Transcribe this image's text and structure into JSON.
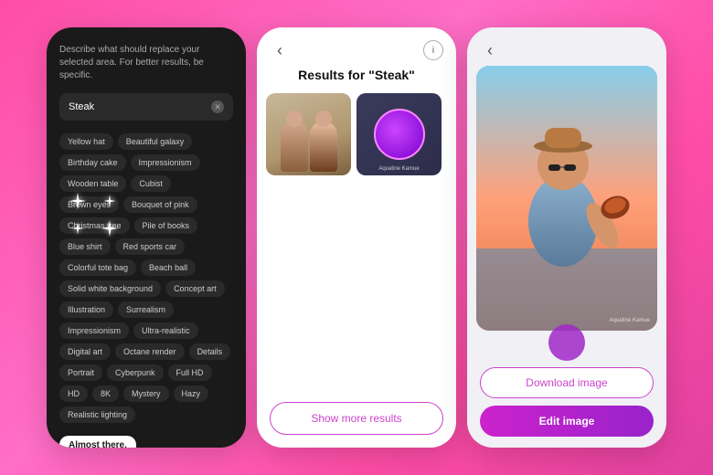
{
  "panel1": {
    "prompt_label": "Describe what should replace your selected area. For better results, be specific.",
    "prompt_value": "Steak",
    "chips": [
      "Yellow hat",
      "Beautiful galaxy",
      "Birthday cake",
      "Impressionism",
      "Wooden table",
      "Cubist",
      "Brown eyes",
      "Bouquet of pink",
      "Christmas tree",
      "Pile of books",
      "Blue shirt",
      "Red sports car",
      "Colorful tote bag",
      "Beach ball",
      "Solid white background",
      "Concept art",
      "Illustration",
      "Surrealism",
      "Impressionism",
      "Ultra-realistic",
      "Digital art",
      "Octane render",
      "Details",
      "Portrait",
      "Cyberpunk",
      "Full HD",
      "HD",
      "8K",
      "Mystery",
      "Hazy",
      "Realistic lighting"
    ],
    "almost_there_label": "Almost there."
  },
  "panel2": {
    "title": "Results for \"Steak\"",
    "show_more_label": "Show more results",
    "thumb1_label": "",
    "thumb2_label": "Aquatine Kamue"
  },
  "panel3": {
    "img_label": "Aquatine Kamue",
    "download_label": "Download image",
    "edit_label": "Edit image"
  },
  "icons": {
    "back": "‹",
    "info": "i",
    "clear": "✕"
  }
}
